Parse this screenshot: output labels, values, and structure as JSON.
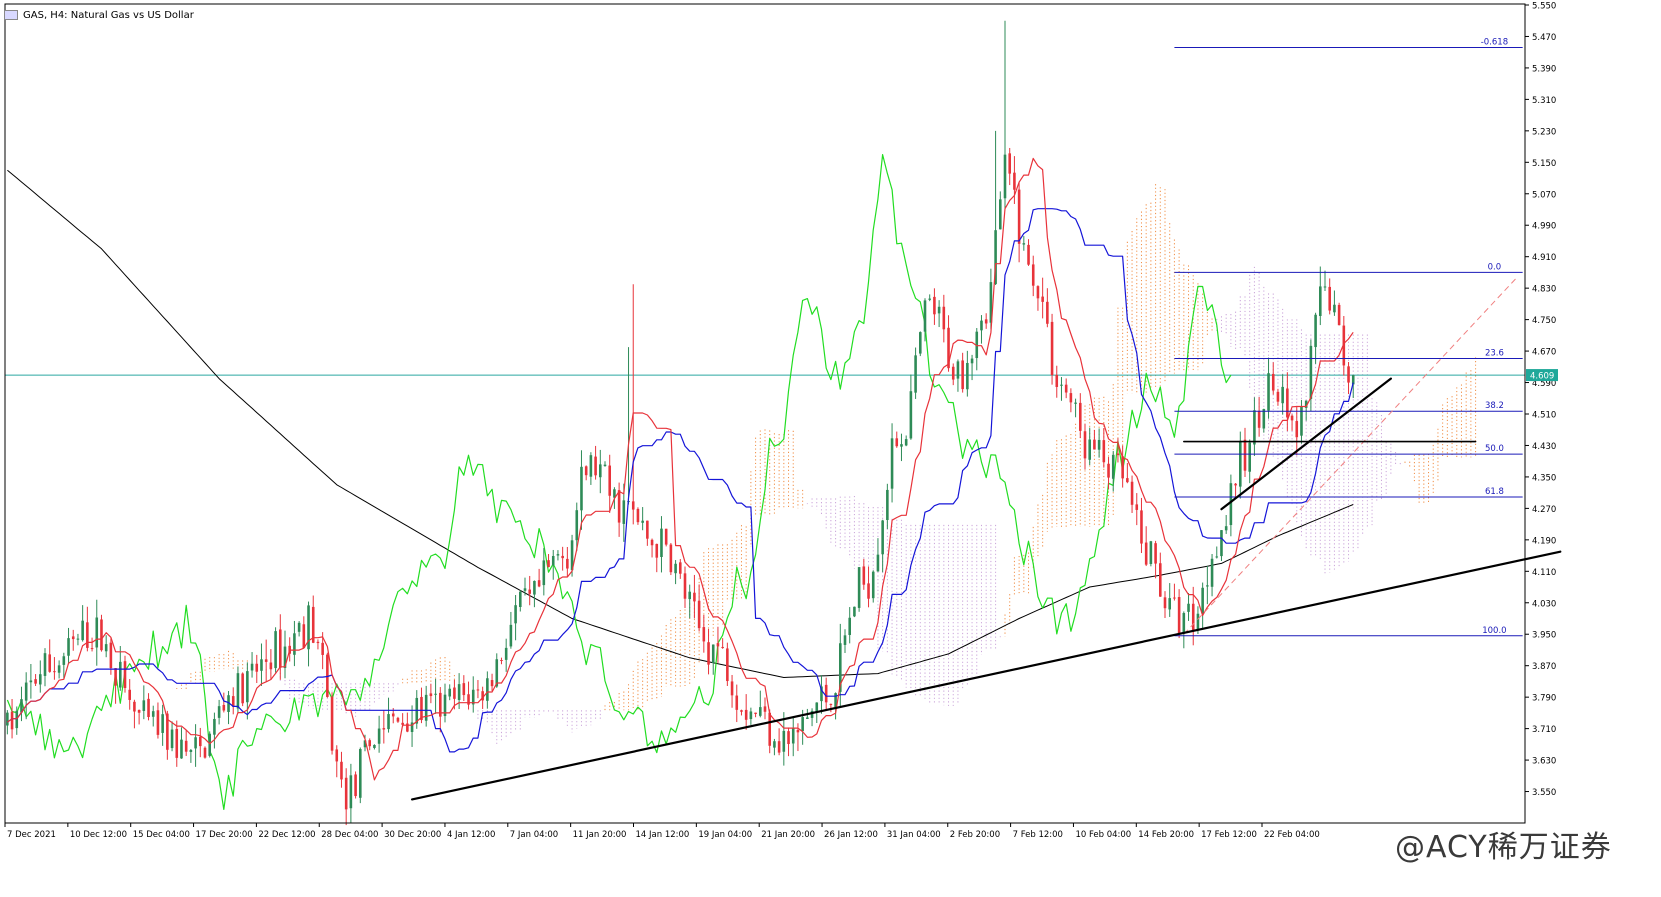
{
  "header": {
    "symbol_line": "GAS, H4:  Natural Gas vs  US Dollar"
  },
  "watermark": "@ACY稀万证券",
  "colors": {
    "bull": "#2e8b57",
    "bear": "#e8333a",
    "tenkan": "#e8333a",
    "kijun": "#1515d8",
    "chikou": "#22dd22",
    "sma": "#000000",
    "cloud_up": "#f0883c",
    "cloud_down": "#c8a0d8",
    "fib": "#1a1ab8",
    "current_line": "#2aa8a0",
    "price_tag_bg": "#1fa89a"
  },
  "chart_data": {
    "type": "candlestick",
    "title": "GAS, H4: Natural Gas vs US Dollar",
    "ylim": [
      3.47,
      5.55
    ],
    "y_ticks": [
      "5.550",
      "5.470",
      "5.390",
      "5.310",
      "5.230",
      "5.150",
      "5.070",
      "4.990",
      "4.910",
      "4.830",
      "4.750",
      "4.670",
      "4.590",
      "4.510",
      "4.430",
      "4.350",
      "4.270",
      "4.190",
      "4.110",
      "4.030",
      "3.950",
      "3.870",
      "3.790",
      "3.710",
      "3.630",
      "3.550"
    ],
    "x_ticks": [
      "7 Dec 2021",
      "10 Dec 12:00",
      "15 Dec 04:00",
      "17 Dec 20:00",
      "22 Dec 12:00",
      "28 Dec 04:00",
      "30 Dec 20:00",
      "4 Jan 12:00",
      "7 Jan 04:00",
      "11 Jan 20:00",
      "14 Jan 12:00",
      "19 Jan 04:00",
      "21 Jan 20:00",
      "26 Jan 12:00",
      "31 Jan 04:00",
      "2 Feb 20:00",
      "7 Feb 12:00",
      "10 Feb 04:00",
      "14 Feb 20:00",
      "17 Feb 12:00",
      "22 Feb 04:00"
    ],
    "current_price": 4.609,
    "current_price_label": "4.609",
    "anchors": [
      {
        "bar": 0,
        "price": 3.72
      },
      {
        "bar": 8,
        "price": 3.86
      },
      {
        "bar": 18,
        "price": 3.95
      },
      {
        "bar": 30,
        "price": 3.72
      },
      {
        "bar": 40,
        "price": 3.64
      },
      {
        "bar": 48,
        "price": 3.8
      },
      {
        "bar": 58,
        "price": 3.91
      },
      {
        "bar": 64,
        "price": 3.98
      },
      {
        "bar": 72,
        "price": 3.55
      },
      {
        "bar": 80,
        "price": 3.72
      },
      {
        "bar": 90,
        "price": 3.76
      },
      {
        "bar": 100,
        "price": 3.8
      },
      {
        "bar": 110,
        "price": 4.02
      },
      {
        "bar": 118,
        "price": 4.15
      },
      {
        "bar": 124,
        "price": 4.38
      },
      {
        "bar": 130,
        "price": 4.28
      },
      {
        "bar": 138,
        "price": 4.18
      },
      {
        "bar": 150,
        "price": 3.92
      },
      {
        "bar": 158,
        "price": 3.76
      },
      {
        "bar": 166,
        "price": 3.68
      },
      {
        "bar": 174,
        "price": 3.79
      },
      {
        "bar": 182,
        "price": 4.08
      },
      {
        "bar": 190,
        "price": 4.46
      },
      {
        "bar": 196,
        "price": 4.78
      },
      {
        "bar": 202,
        "price": 4.62
      },
      {
        "bar": 208,
        "price": 4.78
      },
      {
        "bar": 212,
        "price": 5.12
      },
      {
        "bar": 218,
        "price": 4.86
      },
      {
        "bar": 224,
        "price": 4.58
      },
      {
        "bar": 230,
        "price": 4.42
      },
      {
        "bar": 236,
        "price": 4.36
      },
      {
        "bar": 242,
        "price": 4.16
      },
      {
        "bar": 248,
        "price": 4.0
      },
      {
        "bar": 252,
        "price": 4.0
      },
      {
        "bar": 258,
        "price": 4.22
      },
      {
        "bar": 262,
        "price": 4.38
      },
      {
        "bar": 268,
        "price": 4.58
      },
      {
        "bar": 274,
        "price": 4.46
      },
      {
        "bar": 280,
        "price": 4.82
      },
      {
        "bar": 286,
        "price": 4.6
      }
    ],
    "spikes": [
      {
        "bar": 133,
        "high": 4.84
      },
      {
        "bar": 132,
        "high": 4.68
      },
      {
        "bar": 212,
        "high": 5.51
      },
      {
        "bar": 210,
        "high": 5.23
      },
      {
        "bar": 72,
        "low": 3.5
      },
      {
        "bar": 166,
        "low": 3.64
      },
      {
        "bar": 252,
        "low": 3.95
      }
    ],
    "fibonacci": {
      "x_start_bar": 248,
      "x_end_bar": 322,
      "label_bar": 316,
      "levels": [
        {
          "label": "-0.618",
          "price": 5.442
        },
        {
          "label": "0.0",
          "price": 4.87
        },
        {
          "label": "23.6",
          "price": 4.651
        },
        {
          "label": "38.2",
          "price": 4.517
        },
        {
          "label": "50.0",
          "price": 4.408
        },
        {
          "label": "61.8",
          "price": 4.299
        },
        {
          "label": "100.0",
          "price": 3.946
        }
      ]
    },
    "trendlines": [
      {
        "b1": 86,
        "p1": 3.53,
        "b2": 330,
        "p2": 4.16,
        "width": 2.2
      },
      {
        "b1": 258,
        "p1": 4.268,
        "b2": 294,
        "p2": 4.6,
        "width": 2.2
      },
      {
        "b1": 250,
        "p1": 4.44,
        "b2": 312,
        "p2": 4.44,
        "width": 1.6
      }
    ],
    "diagonal_dashed": {
      "b1": 250,
      "p1": 3.95,
      "b2": 321,
      "p2": 4.86
    },
    "sma_anchors": [
      {
        "bar": 0,
        "price": 5.13
      },
      {
        "bar": 20,
        "price": 4.93
      },
      {
        "bar": 45,
        "price": 4.6
      },
      {
        "bar": 70,
        "price": 4.33
      },
      {
        "bar": 100,
        "price": 4.12
      },
      {
        "bar": 120,
        "price": 3.99
      },
      {
        "bar": 145,
        "price": 3.89
      },
      {
        "bar": 165,
        "price": 3.84
      },
      {
        "bar": 185,
        "price": 3.85
      },
      {
        "bar": 200,
        "price": 3.9
      },
      {
        "bar": 215,
        "price": 3.99
      },
      {
        "bar": 230,
        "price": 4.07
      },
      {
        "bar": 245,
        "price": 4.1
      },
      {
        "bar": 258,
        "price": 4.13
      },
      {
        "bar": 270,
        "price": 4.2
      },
      {
        "bar": 286,
        "price": 4.28
      }
    ]
  }
}
